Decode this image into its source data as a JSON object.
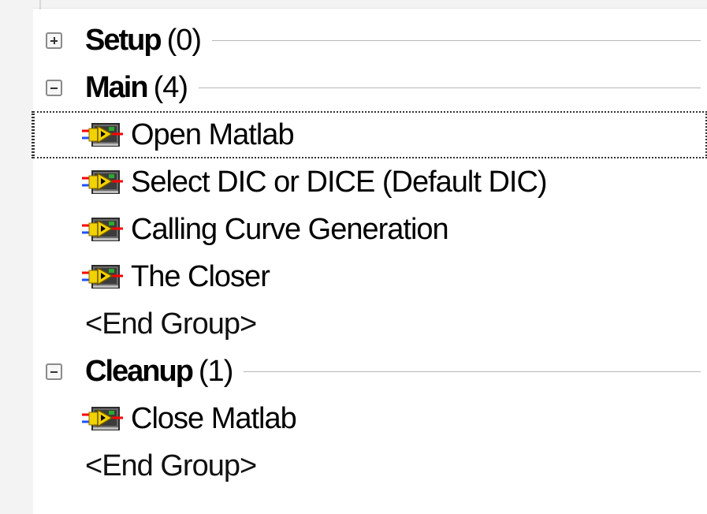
{
  "groups": [
    {
      "name": "Setup",
      "count": "(0)",
      "expanded": false,
      "steps": [],
      "end": ""
    },
    {
      "name": "Main",
      "count": "(4)",
      "expanded": true,
      "steps": [
        "Open Matlab",
        "Select DIC or DICE (Default DIC)",
        "Calling Curve Generation",
        "The Closer"
      ],
      "end": "<End Group>"
    },
    {
      "name": "Cleanup",
      "count": "(1)",
      "expanded": true,
      "steps": [
        "Close Matlab"
      ],
      "end": "<End Group>"
    }
  ],
  "selected_step": "Open Matlab",
  "icons": {
    "expand": "plus-box-icon",
    "collapse": "minus-box-icon",
    "step": "labview-vi-step-icon"
  },
  "colors": {
    "group_separator": "#b8b8b8",
    "selection_outline": "#333333",
    "icon_yellow": "#f2d200",
    "icon_red_wire": "#ff0000",
    "icon_blue_wire": "#2050ff"
  }
}
